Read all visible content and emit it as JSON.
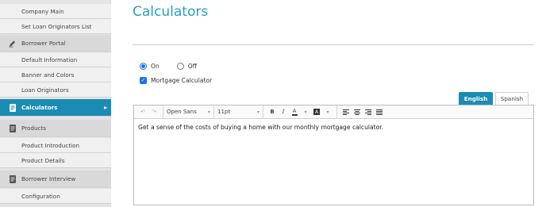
{
  "page": {
    "title": "Calculators"
  },
  "sidebar": {
    "items": [
      {
        "label": "Company Main",
        "type": "sub"
      },
      {
        "label": "Set Loan Originators List",
        "type": "sub"
      },
      {
        "label": "Borrower Portal",
        "type": "section",
        "icon": "pen-icon"
      },
      {
        "label": "Default Information",
        "type": "sub"
      },
      {
        "label": "Banner and Colors",
        "type": "sub"
      },
      {
        "label": "Loan Originators",
        "type": "sub"
      },
      {
        "label": "Calculators",
        "type": "section",
        "icon": "document-icon",
        "active": true
      },
      {
        "label": "Products",
        "type": "section",
        "icon": "document-icon"
      },
      {
        "label": "Product Introduction",
        "type": "sub"
      },
      {
        "label": "Product Details",
        "type": "sub"
      },
      {
        "label": "Borrower Interview",
        "type": "section",
        "icon": "document-icon"
      },
      {
        "label": "Configuration",
        "type": "sub"
      }
    ]
  },
  "toggle": {
    "on_label": "On",
    "off_label": "Off",
    "selected": "On"
  },
  "mortgage_calc": {
    "label": "Mortgage Calculator",
    "checked": true
  },
  "tabs": {
    "english": "English",
    "spanish": "Spanish",
    "active": "English"
  },
  "editor": {
    "font_family_value": "Open Sans",
    "font_size_value": "11pt",
    "content": "Get a sense of the costs of buying a home with our monthly mortgage calculator."
  },
  "colors": {
    "accent": "#1b8cb3",
    "title": "#2a9ec0",
    "checkbox": "#1a73e8"
  }
}
